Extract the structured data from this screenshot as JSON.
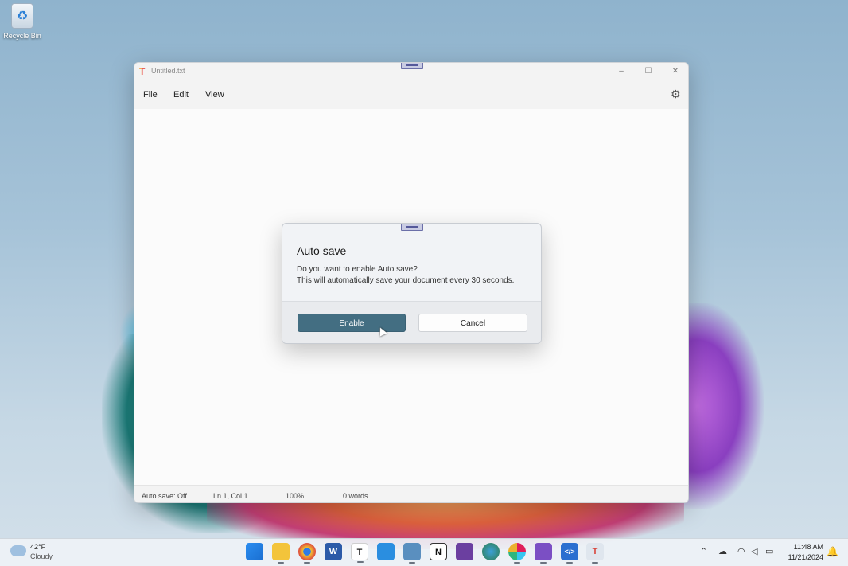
{
  "desktop": {
    "recycle_bin_label": "Recycle Bin"
  },
  "window": {
    "title": "Untitled.txt",
    "controls": {
      "minimize": "–",
      "maximize": "☐",
      "close": "✕"
    },
    "menu": {
      "file": "File",
      "edit": "Edit",
      "view": "View"
    },
    "settings_icon": "gear-icon"
  },
  "status_bar": {
    "auto_save": "Auto save: Off",
    "position": "Ln 1, Col 1",
    "zoom": "100%",
    "words": "0 words"
  },
  "dialog": {
    "title": "Auto save",
    "message_line1": "Do you want to enable Auto save?",
    "message_line2": "This will automatically save your document every 30 seconds.",
    "primary_button": "Enable",
    "secondary_button": "Cancel",
    "accent_color": "#436e82"
  },
  "taskbar": {
    "weather_temp": "42°F",
    "weather_condition": "Cloudy",
    "apps": [
      {
        "name": "start-icon",
        "glyph": ""
      },
      {
        "name": "file-explorer-icon",
        "glyph": ""
      },
      {
        "name": "chrome-icon",
        "glyph": ""
      },
      {
        "name": "word-icon",
        "glyph": "W"
      },
      {
        "name": "typora-icon",
        "glyph": "T"
      },
      {
        "name": "vscode-icon",
        "glyph": ""
      },
      {
        "name": "notepad-icon",
        "glyph": ""
      },
      {
        "name": "notion-icon",
        "glyph": "N"
      },
      {
        "name": "affinity-icon",
        "glyph": ""
      },
      {
        "name": "maps-icon",
        "glyph": ""
      },
      {
        "name": "slack-icon",
        "glyph": ""
      },
      {
        "name": "visual-studio-icon",
        "glyph": ""
      },
      {
        "name": "dev-tools-icon",
        "glyph": "</>"
      },
      {
        "name": "text-editor-icon",
        "glyph": "T"
      }
    ],
    "clock_time": "11:48 AM",
    "clock_date": "11/21/2024"
  }
}
